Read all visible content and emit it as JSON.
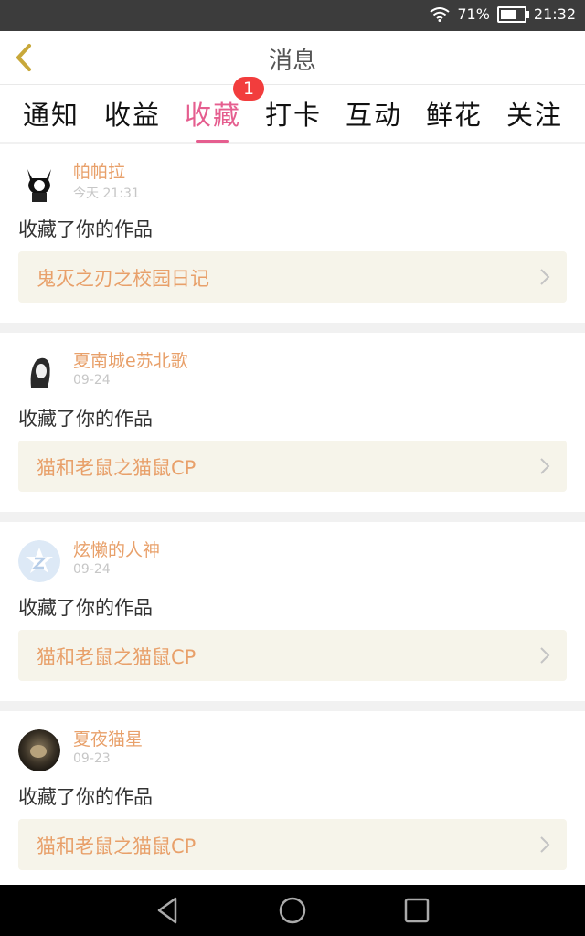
{
  "status": {
    "battery": "71%",
    "battery_level": 0.71,
    "time": "21:32"
  },
  "header": {
    "title": "消息"
  },
  "tabs": [
    {
      "label": "通知"
    },
    {
      "label": "收益"
    },
    {
      "label": "收藏",
      "badge": "1"
    },
    {
      "label": "打卡"
    },
    {
      "label": "互动"
    },
    {
      "label": "鲜花"
    },
    {
      "label": "关注"
    }
  ],
  "active_tab": "收藏",
  "colors": {
    "accent": "#e55e8f",
    "name": "#e8a06a",
    "badge": "#f23d3d"
  },
  "messages": [
    {
      "user": "帕帕拉",
      "time": "今天 21:31",
      "text": "收藏了你的作品",
      "work": "鬼灭之刃之校园日记",
      "avatar": "cat-girl-avatar"
    },
    {
      "user": "夏南城e苏北歌",
      "time": "09-24",
      "text": "收藏了你的作品",
      "work": "猫和老鼠之猫鼠CP",
      "avatar": "girl-sketch-avatar"
    },
    {
      "user": "炫懒的人神",
      "time": "09-24",
      "text": "收藏了你的作品",
      "work": "猫和老鼠之猫鼠CP",
      "avatar": "qzone-star-avatar"
    },
    {
      "user": "夏夜猫星",
      "time": "09-23",
      "text": "收藏了你的作品",
      "work": "猫和老鼠之猫鼠CP",
      "avatar": "cat-photo-avatar"
    }
  ]
}
